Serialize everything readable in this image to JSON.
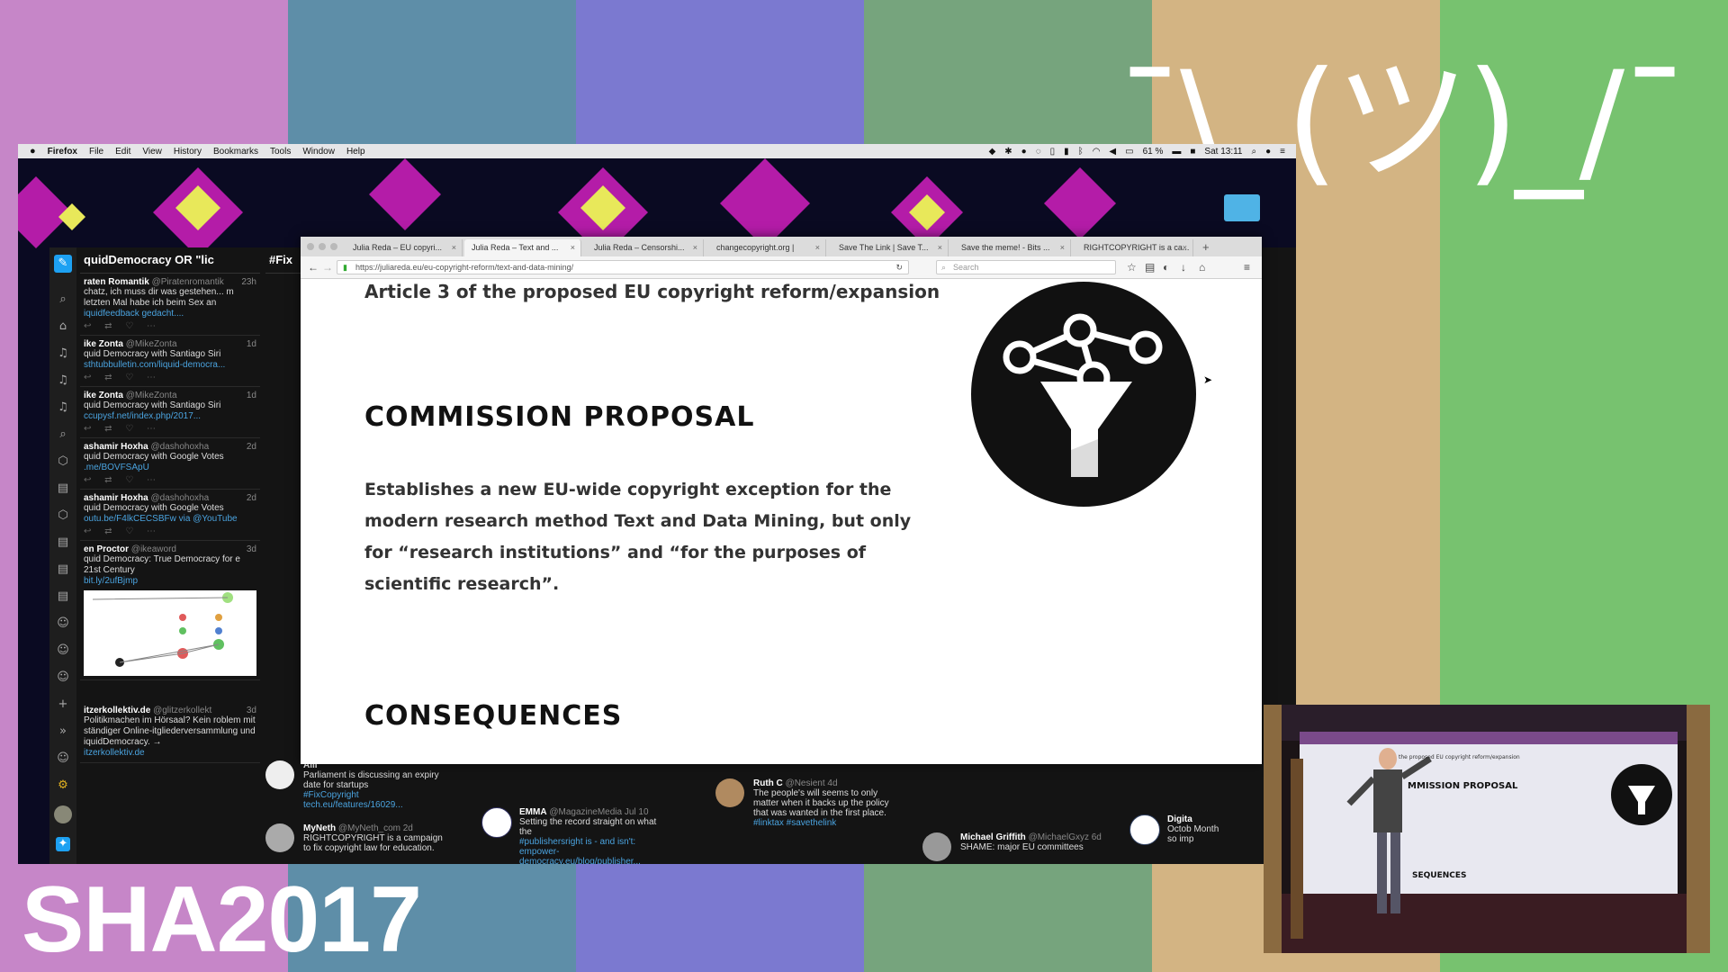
{
  "overlay": {
    "shrug": "¯\\_(ツ)_/¯",
    "event": "SHA2017",
    "stripe_colors": [
      "#c686c8",
      "#5e8ea8",
      "#7b79d0",
      "#76a47d",
      "#d3b483",
      "#77c26f"
    ]
  },
  "menubar": {
    "apple": "",
    "app": "Firefox",
    "items": [
      "File",
      "Edit",
      "View",
      "History",
      "Bookmarks",
      "Tools",
      "Window",
      "Help"
    ],
    "battery": "61 %",
    "clock": "Sat 13:11"
  },
  "tweetdeck": {
    "col1_title": "quidDemocracy OR \"lic",
    "col2_title": "#Fix",
    "tweets": [
      {
        "name": "raten Romantik",
        "handle": "@Piratenromantik",
        "time": "23h",
        "text": "chatz, ich muss dir was gestehen... m letzten Mal habe ich beim Sex an",
        "link": "iquidfeedback gedacht...."
      },
      {
        "name": "ike Zonta",
        "handle": "@MikeZonta",
        "time": "1d",
        "text": "quid Democracy with Santiago Siri",
        "link": "sthtubbulletin.com/liquid-democra..."
      },
      {
        "name": "ike Zonta",
        "handle": "@MikeZonta",
        "time": "1d",
        "text": "quid Democracy with Santiago Siri",
        "link": "ccupysf.net/index.php/2017..."
      },
      {
        "name": "ashamir Hoxha",
        "handle": "@dashohoxha",
        "time": "2d",
        "text": "quid Democracy with Google Votes",
        "link": ".me/BOVFSApU"
      },
      {
        "name": "ashamir Hoxha",
        "handle": "@dashohoxha",
        "time": "2d",
        "text": "quid Democracy with Google Votes",
        "link": "outu.be/F4lkCECSBFw via @YouTube"
      },
      {
        "name": "en Proctor",
        "handle": "@ikeaword",
        "time": "3d",
        "text": "quid Democracy: True Democracy for e 21st Century",
        "link": "bit.ly/2ufBjmp"
      },
      {
        "name": "itzerkollektiv.de",
        "handle": "@glitzerkollekt",
        "time": "3d",
        "text": "Politikmachen im Hörsaal? Kein roblem mit ständiger Online-itgliederversammlung und iquidDemocracy. →",
        "link": "itzerkollektiv.de"
      }
    ],
    "bottom": [
      {
        "name": "AllI",
        "text": "Parliament is discussing an expiry date for startups",
        "link": "#FixCopyright tech.eu/features/16029..."
      },
      {
        "name": "MyNeth",
        "handle": "@MyNeth_com",
        "time": "2d",
        "text": "RIGHTCOPYRIGHT is a campaign to fix copyright law for education."
      },
      {
        "name": "EMMA",
        "handle": "@MagazineMedia",
        "time": "Jul 10",
        "text": "Setting the record straight on what the",
        "link": "#publishersright is - and isn't: empower-democracy.eu/blog/publisher..."
      },
      {
        "name": "Ruth C",
        "handle": "@Nesient",
        "time": "4d",
        "text": "The people's will seems to only matter when it backs up the policy that was wanted in the first place.",
        "link": "#linktax #savethelink"
      },
      {
        "name": "Michael Griffith",
        "handle": "@MichaelGxyz",
        "time": "6d",
        "text": "SHAME: major EU committees"
      },
      {
        "name": "Digita",
        "text": "Octob Month so imp"
      }
    ]
  },
  "firefox": {
    "tabs": [
      {
        "label": "Julia Reda – EU copyri...",
        "active": false
      },
      {
        "label": "Julia Reda – Text and ...",
        "active": true
      },
      {
        "label": "Julia Reda – Censorshi...",
        "active": false
      },
      {
        "label": "changecopyright.org |",
        "active": false
      },
      {
        "label": "Save The Link | Save T...",
        "active": false
      },
      {
        "label": "Save the meme! - Bits ...",
        "active": false
      },
      {
        "label": "RIGHTCOPYRIGHT is a ca...",
        "active": false
      }
    ],
    "url": "https://juliareda.eu/eu-copyright-reform/text-and-data-mining/",
    "search_placeholder": "Search",
    "page": {
      "article": "Article 3 of the proposed EU copyright reform/expansion",
      "heading1": "COMMISSION PROPOSAL",
      "body": "Establishes a new EU-wide copyright exception for the modern research method Text and Data Mining, but only for “research institutions” and “for the purposes of scientific research”.",
      "heading2": "CONSEQUENCES"
    }
  },
  "camera": {
    "slide_heading1": "MMISSION PROPOSAL",
    "slide_heading2": "SEQUENCES",
    "slide_article": "the proposed EU copyright reform/expansion"
  }
}
